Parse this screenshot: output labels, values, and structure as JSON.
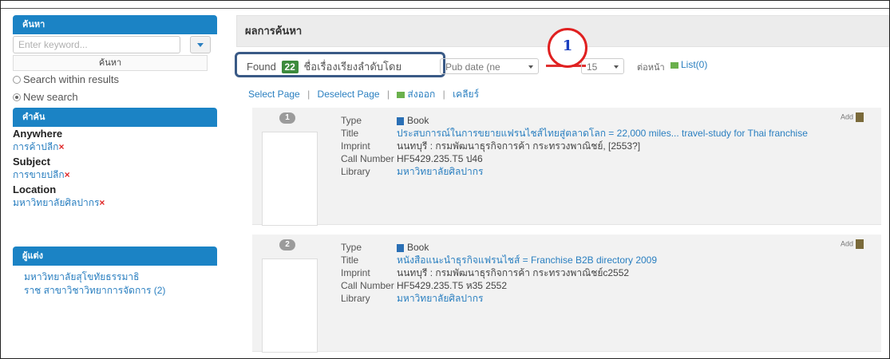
{
  "sidebar": {
    "search_header": "ค้นหา",
    "search_placeholder": "Enter keyword...",
    "search_button": "ค้นหา",
    "radio_within": "Search within results",
    "radio_new": "New search",
    "keywords_header": "คำค้น",
    "facets": [
      {
        "label": "Anywhere",
        "value": "การค้าปลีก"
      },
      {
        "label": "Subject",
        "value": "การขายปลีก"
      },
      {
        "label": "Location",
        "value": "มหาวิทยาลัยศิลปากร"
      }
    ],
    "author_header": "ผู้แต่ง",
    "authors": [
      "มหาวิทยาลัยสุโขทัยธรรมาธิ",
      "ราช สาขาวิชาวิทยาการจัดการ (2)"
    ]
  },
  "main": {
    "results_title": "ผลการค้นหา",
    "found_label": "Found",
    "found_count": "22",
    "found_suffix": "ชื่อเรื่อง",
    "sort_label": "เรียงลำดับโดย",
    "sort_value": "Pub date (ne",
    "page_size": "15",
    "per_page_label": "ต่อหน้า",
    "list_label": "List(0)",
    "callout_number": "1",
    "select_page": "Select Page",
    "deselect_page": "Deselect Page",
    "export_label": "ส่งออก",
    "clear_label": "เคลียร์",
    "field_labels": {
      "type": "Type",
      "title": "Title",
      "imprint": "Imprint",
      "call_number": "Call Number",
      "library": "Library"
    },
    "add_label": "Add",
    "results": [
      {
        "number": "1",
        "type": "Book",
        "title": "ประสบการณ์ในการขยายแฟรนไชส์ไทยสู่ตลาดโลก = 22,000 miles... travel-study for Thai franchise",
        "imprint": "นนทบุรี : กรมพัฒนาธุรกิจการค้า กระทรวงพาณิชย์, [2553?]",
        "call_number": "HF5429.235.T5 ป46",
        "library": "มหาวิทยาลัยศิลปากร"
      },
      {
        "number": "2",
        "type": "Book",
        "title": "หนังสือแนะนำธุรกิจแฟรนไชส์ = Franchise B2B directory 2009",
        "imprint": "นนทบุรี : กรมพัฒนาธุรกิจการค้า กระทรวงพาณิชย์c2552",
        "call_number": "HF5429.235.T5 ห35 2552",
        "library": "มหาวิทยาลัยศิลปากร"
      }
    ]
  }
}
